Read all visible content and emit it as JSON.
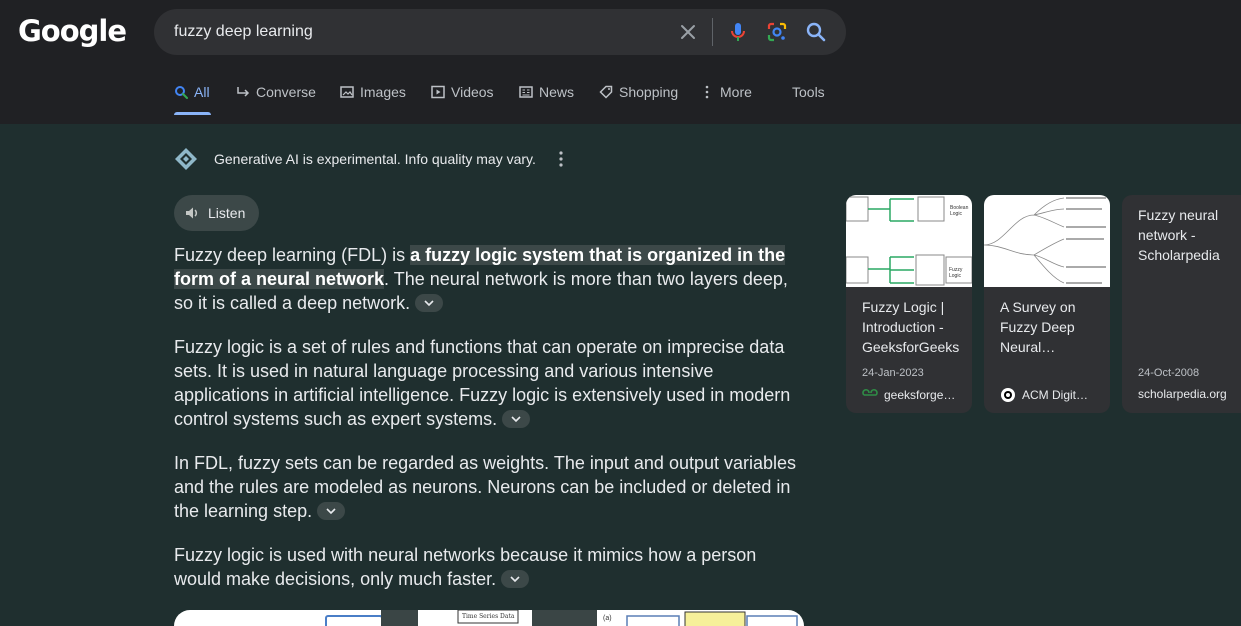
{
  "logo": {
    "text": "Google"
  },
  "search": {
    "query": "fuzzy deep learning"
  },
  "tabs": [
    {
      "label": "All",
      "icon": "search-icon"
    },
    {
      "label": "Converse",
      "icon": "converse-icon"
    },
    {
      "label": "Images",
      "icon": "image-icon"
    },
    {
      "label": "Videos",
      "icon": "video-icon"
    },
    {
      "label": "News",
      "icon": "news-icon"
    },
    {
      "label": "Shopping",
      "icon": "tag-icon"
    },
    {
      "label": "More",
      "icon": "more-vert-icon"
    },
    {
      "label": "Tools"
    }
  ],
  "ai": {
    "notice": "Generative AI is experimental. Info quality may vary.",
    "listen_label": "Listen"
  },
  "answer": {
    "p1_prefix": "Fuzzy deep learning (FDL) is ",
    "p1_highlight": "a fuzzy logic system that is organized in the form of a neural network",
    "p1_suffix": ". The neural network is more than two layers deep, so it is called a deep network.",
    "p2": "Fuzzy logic is a set of rules and functions that can operate on imprecise data sets. It is used in natural language processing and various intensive applications in artificial intelligence. Fuzzy logic is extensively used in modern control systems such as expert systems.",
    "p3": "In FDL, fuzzy sets can be regarded as weights. The input and output variables and the rules are modeled as neurons. Neurons can be included or deleted in the learning step.",
    "p4": "Fuzzy logic is used with neural networks because it mimics how a person would make decisions, only much faster."
  },
  "sources": [
    {
      "title": "Fuzzy Logic | Introduction - GeeksforGeeks",
      "date": "24-Jan-2023",
      "source": "geeksforge…",
      "thumb_text": [
        "Boolean Logic",
        "Fuzzy Logic"
      ]
    },
    {
      "title": "A Survey on Fuzzy Deep Neural…",
      "date": "",
      "source": "ACM Digit…"
    },
    {
      "title": "Fuzzy neural network - Scholarpedia",
      "date": "24-Oct-2008",
      "source": "scholarpedia.org"
    }
  ],
  "strip": {
    "label": "Time Series Data",
    "panel_label": "(a)"
  },
  "colors": {
    "accent": "#8ab4f8",
    "background": "#1f2f2f",
    "header": "#202124"
  }
}
